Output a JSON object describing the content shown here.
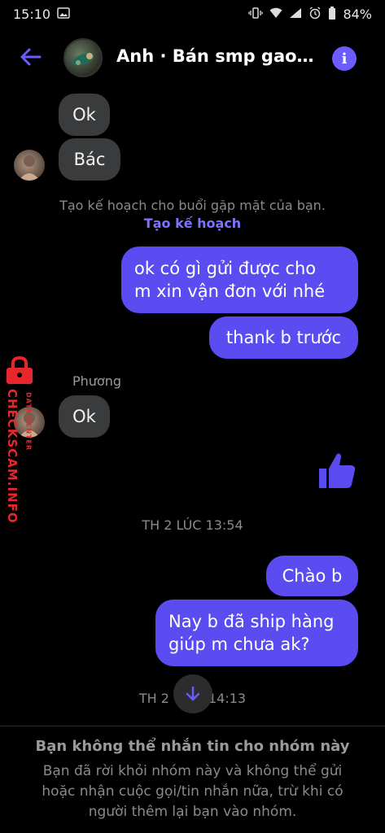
{
  "status_bar": {
    "time": "15:10",
    "battery": "84%"
  },
  "header": {
    "title": "Anh · Bán smp gao…",
    "back_icon": "arrow-left-icon",
    "info_icon": "info-icon",
    "accent": "#6a5cff"
  },
  "messages": {
    "incoming_1": "Ok",
    "incoming_2": "Bác",
    "system_plan_text": "Tạo kế hoạch cho buổi gặp mặt của bạn.",
    "system_plan_link": "Tạo kế hoạch",
    "outgoing_1_line1": "ok có gì gửi được cho",
    "outgoing_1_line2": "m xin vận đơn với nhé",
    "outgoing_2": "thank b trước",
    "sender_name": "Phương",
    "incoming_3": "Ok",
    "timestamp_1": "TH 2 LÚC 13:54",
    "outgoing_3": "Chào b",
    "outgoing_4_line1": "Nay b đã ship hàng",
    "outgoing_4_line2": "giúp m chưa ak?",
    "timestamp_2_left": "TH 2",
    "timestamp_2_right": "14:13"
  },
  "footer": {
    "title": "Bạn không thể nhắn tin cho nhóm này",
    "body": "Bạn đã rời khỏi nhóm này và không thể gửi hoặc nhận cuộc gọi/tin nhắn nữa, trừ khi có người thêm lại bạn vào nhóm."
  },
  "watermark": {
    "main": "CHECKSCAM.INFO",
    "sub": "DATA CENTER",
    "color": "#e8262b"
  },
  "colors": {
    "outgoing_bubble": "#5b4cf2",
    "incoming_bubble": "#3a3b3c",
    "background": "#000000"
  }
}
